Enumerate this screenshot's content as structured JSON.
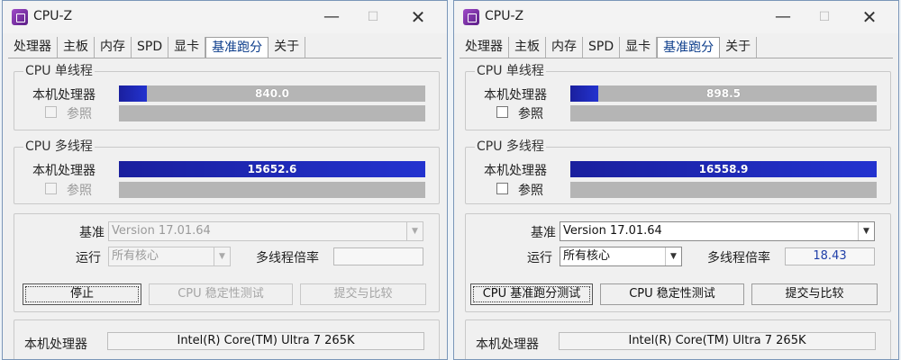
{
  "windows": [
    {
      "title": "CPU-Z",
      "tabs": [
        "处理器",
        "主板",
        "内存",
        "SPD",
        "显卡",
        "基准跑分",
        "关于"
      ],
      "active_tab": 5,
      "single_thread": {
        "group_title": "CPU 单线程",
        "this_cpu_label": "本机处理器",
        "score": "840.0",
        "score_fraction": 0.09,
        "reference_label": "参照"
      },
      "multi_thread": {
        "group_title": "CPU 多线程",
        "this_cpu_label": "本机处理器",
        "score": "15652.6",
        "score_fraction": 1.0,
        "reference_label": "参照"
      },
      "settings": {
        "benchmark_label": "基准",
        "benchmark_value": "Version 17.01.64",
        "run_label": "运行",
        "run_value": "所有核心",
        "ratio_label": "多线程倍率",
        "ratio_value": ""
      },
      "buttons": {
        "primary": "停止",
        "stress": "CPU 稳定性测试",
        "submit": "提交与比较"
      },
      "processor": {
        "label": "本机处理器",
        "value": "Intel(R) Core(TM) Ultra 7 265K"
      },
      "running": true
    },
    {
      "title": "CPU-Z",
      "tabs": [
        "处理器",
        "主板",
        "内存",
        "SPD",
        "显卡",
        "基准跑分",
        "关于"
      ],
      "active_tab": 5,
      "single_thread": {
        "group_title": "CPU 单线程",
        "this_cpu_label": "本机处理器",
        "score": "898.5",
        "score_fraction": 0.09,
        "reference_label": "参照"
      },
      "multi_thread": {
        "group_title": "CPU 多线程",
        "this_cpu_label": "本机处理器",
        "score": "16558.9",
        "score_fraction": 1.0,
        "reference_label": "参照"
      },
      "settings": {
        "benchmark_label": "基准",
        "benchmark_value": "Version 17.01.64",
        "run_label": "运行",
        "run_value": "所有核心",
        "ratio_label": "多线程倍率",
        "ratio_value": "18.43"
      },
      "buttons": {
        "primary": "CPU 基准跑分测试",
        "stress": "CPU 稳定性测试",
        "submit": "提交与比较"
      },
      "processor": {
        "label": "本机处理器",
        "value": "Intel(R) Core(TM) Ultra 7 265K"
      },
      "running": false
    }
  ],
  "colors": {
    "bar_fill": "#2333cf",
    "bar_track": "#b5b5b5",
    "active_tab_text": "#0a3b8a"
  }
}
